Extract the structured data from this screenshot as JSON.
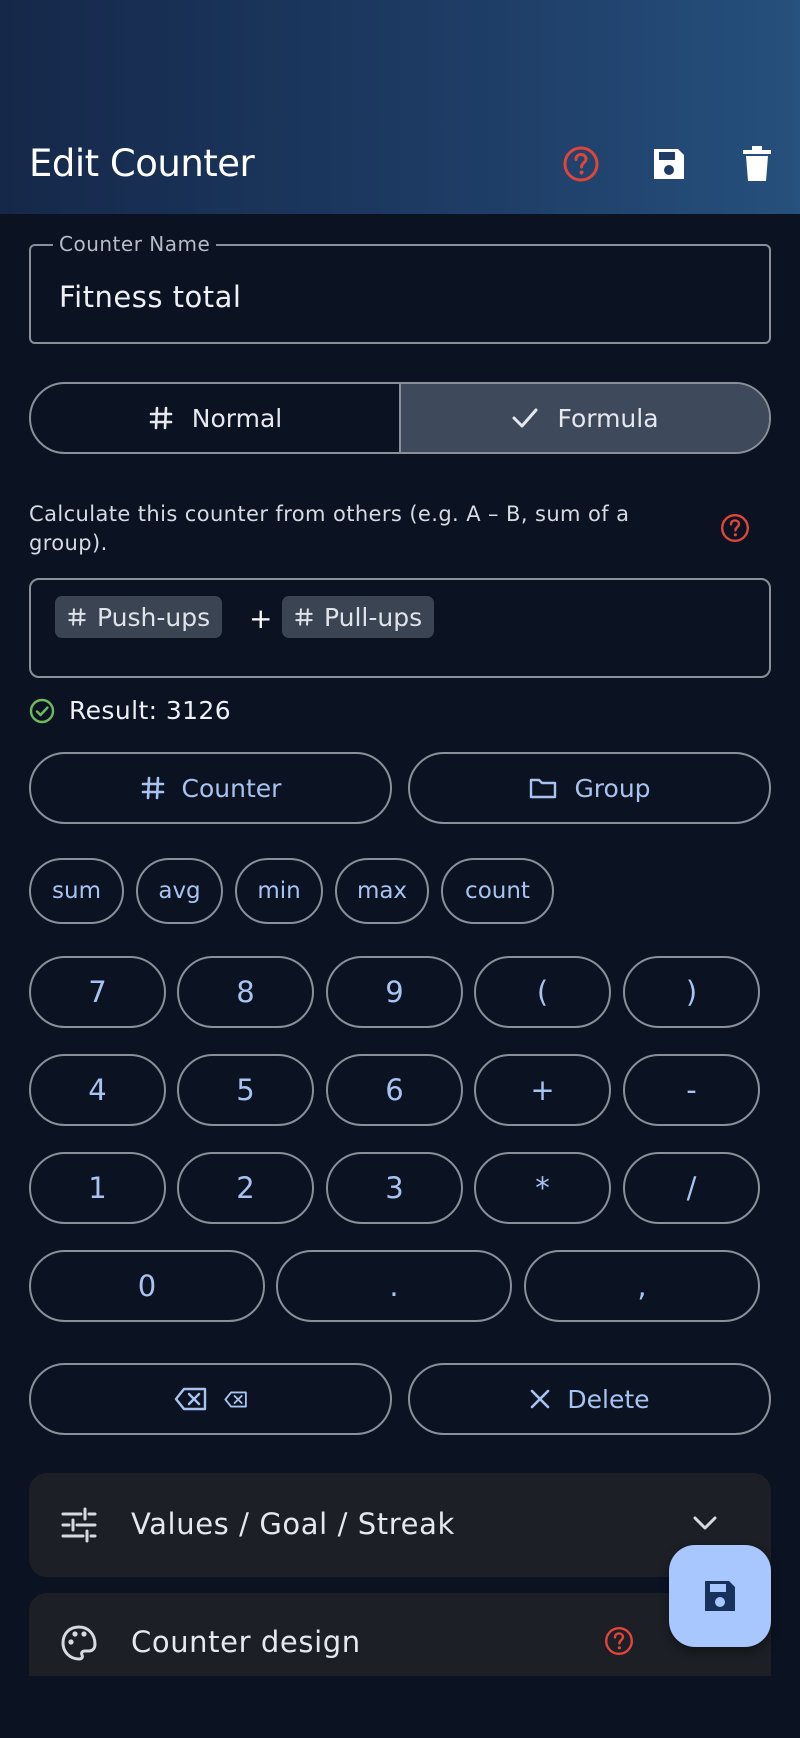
{
  "header": {
    "title": "Edit Counter",
    "help_icon": "help-circle-icon",
    "save_icon": "floppy-disk-icon",
    "delete_icon": "trash-icon"
  },
  "name_field": {
    "label": "Counter Name",
    "value": "Fitness total"
  },
  "mode": {
    "normal_label": "Normal",
    "formula_label": "Formula",
    "selected": "Formula"
  },
  "description": "Calculate this counter from others (e.g. A – B, sum of a group).",
  "formula": {
    "tokens": [
      {
        "label": "Push-ups"
      },
      {
        "op": "+"
      },
      {
        "label": "Pull-ups"
      }
    ]
  },
  "result_text": "Result: 3126",
  "insert": {
    "counter_label": "Counter",
    "group_label": "Group"
  },
  "functions": [
    "sum",
    "avg",
    "min",
    "max",
    "count"
  ],
  "keypad": {
    "row1": [
      "7",
      "8",
      "9",
      "(",
      ")"
    ],
    "row2": [
      "4",
      "5",
      "6",
      "+",
      "-"
    ],
    "row3": [
      "1",
      "2",
      "3",
      "*",
      "/"
    ],
    "row4": [
      "0",
      ".",
      ","
    ]
  },
  "actions": {
    "delete_label": "Delete"
  },
  "sections": {
    "values_label": "Values / Goal / Streak",
    "design_label": "Counter design"
  },
  "colors": {
    "accent": "#a9c3f0",
    "help_red": "#e0453a",
    "fab": "#a9c7ff",
    "success": "#6dbb5e"
  }
}
